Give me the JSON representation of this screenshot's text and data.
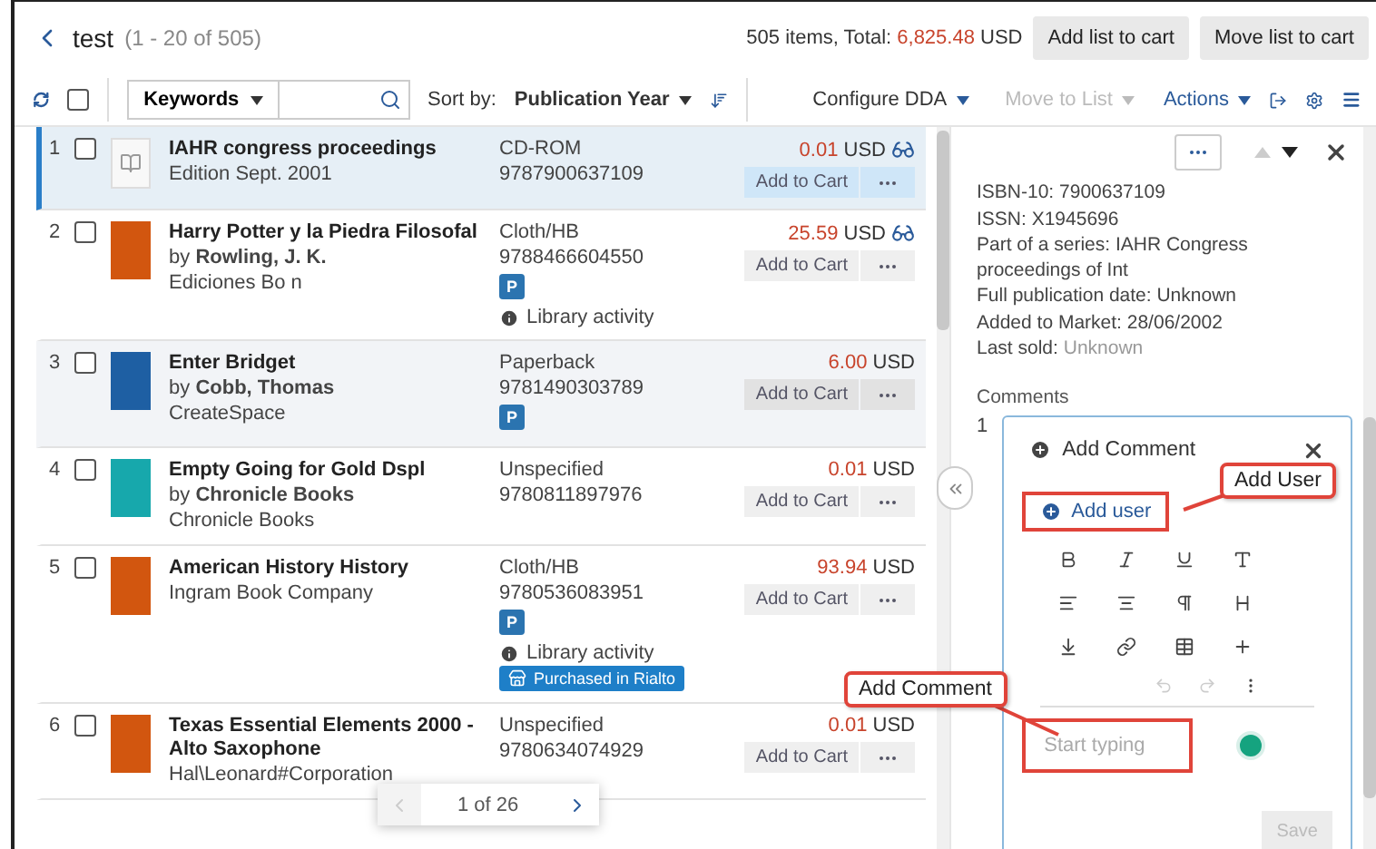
{
  "header": {
    "title": "test",
    "range": "(1 - 20 of 505)",
    "summary_label": "505 items, Total:",
    "total": "6,825.48",
    "currency": "USD",
    "buttons": [
      "Add list to cart",
      "Move list to cart"
    ]
  },
  "toolbar": {
    "select_all_checked": false,
    "search_scope": "Keywords",
    "sort_label": "Sort by:",
    "sort_value": "Publication Year",
    "configure": "Configure DDA",
    "move_to_list": {
      "label": "Move to List",
      "disabled": true
    },
    "actions": "Actions"
  },
  "rows": [
    {
      "number": "1",
      "checked": false,
      "selected": true,
      "hovered": false,
      "cover": {
        "kind": "placeholder"
      },
      "title": "IAHR congress proceedings",
      "subtitle": "Edition Sept. 2001",
      "format": "CD-ROM",
      "isbn": "9787900637109",
      "price": "0.01",
      "currency": "USD",
      "link_icon": true,
      "add_to_cart": "Add to Cart"
    },
    {
      "number": "2",
      "checked": false,
      "selected": false,
      "hovered": false,
      "cover": {
        "kind": "image",
        "color": "#d2560f"
      },
      "title": "Harry Potter y la Piedra Filosofal",
      "subtitle": "by **Rowling, J. K.**",
      "publisher": "Ediciones Bo n",
      "format": "Cloth/HB",
      "isbn": "9788466604550",
      "badge": "P",
      "activity": "Library activity",
      "price": "25.59",
      "currency": "USD",
      "link_icon": true,
      "add_to_cart": "Add to Cart"
    },
    {
      "number": "3",
      "checked": false,
      "selected": false,
      "hovered": true,
      "cover": {
        "kind": "image",
        "color": "#1e5fa3"
      },
      "title": "Enter Bridget",
      "subtitle": "by **Cobb, Thomas**",
      "publisher": "CreateSpace",
      "format": "Paperback",
      "isbn": "9781490303789",
      "badge": "P",
      "price": "6.00",
      "currency": "USD",
      "link_icon": false,
      "add_to_cart": "Add to Cart"
    },
    {
      "number": "4",
      "checked": false,
      "selected": false,
      "hovered": false,
      "cover": {
        "kind": "image",
        "color": "#17a8ac"
      },
      "title": "Empty Going for Gold Dspl",
      "subtitle": "by **Chronicle Books**",
      "publisher": "Chronicle Books",
      "format": "Unspecified",
      "isbn": "9780811897976",
      "price": "0.01",
      "currency": "USD",
      "link_icon": false,
      "add_to_cart": "Add to Cart"
    },
    {
      "number": "5",
      "checked": false,
      "selected": false,
      "hovered": false,
      "cover": {
        "kind": "image",
        "color": "#d2560f"
      },
      "title": "American History History",
      "subtitle": "Ingram Book Company",
      "format": "Cloth/HB",
      "isbn": "9780536083951",
      "badge": "P",
      "activity": "Library activity",
      "tag": "Purchased in Rialto",
      "price": "93.94",
      "currency": "USD",
      "link_icon": false,
      "add_to_cart": "Add to Cart"
    },
    {
      "number": "6",
      "checked": false,
      "selected": false,
      "hovered": false,
      "cover": {
        "kind": "image",
        "color": "#d2560f"
      },
      "title": "Texas Essential Elements 2000 - Alto Saxophone",
      "subtitle": "Hal\\Leonard#Corporation",
      "format": "Unspecified",
      "isbn": "9780634074929",
      "price": "0.01",
      "currency": "USD",
      "link_icon": false,
      "add_to_cart": "Add to Cart"
    }
  ],
  "pagination": {
    "page": "1 of 26",
    "prev_disabled": true
  },
  "panel": {
    "details": [
      {
        "label": "ISBN-10: 7900637109"
      },
      {
        "label": "ISSN: X1945696"
      },
      {
        "label": "Part of a series: IAHR Congress proceedings of Int"
      },
      {
        "label": "Full publication date: Unknown"
      },
      {
        "label": "Added to Market: 28/06/2002"
      },
      {
        "label": "Last sold:",
        "value": "Unknown"
      }
    ],
    "comments_title": "Comments",
    "comment_index": "1",
    "comment": {
      "title": "Add Comment",
      "add_user": "Add user",
      "placeholder": "Start typing",
      "save": "Save",
      "save_disabled": true
    }
  },
  "callouts": [
    {
      "text": "Add User"
    },
    {
      "text": "Add Comment"
    }
  ]
}
